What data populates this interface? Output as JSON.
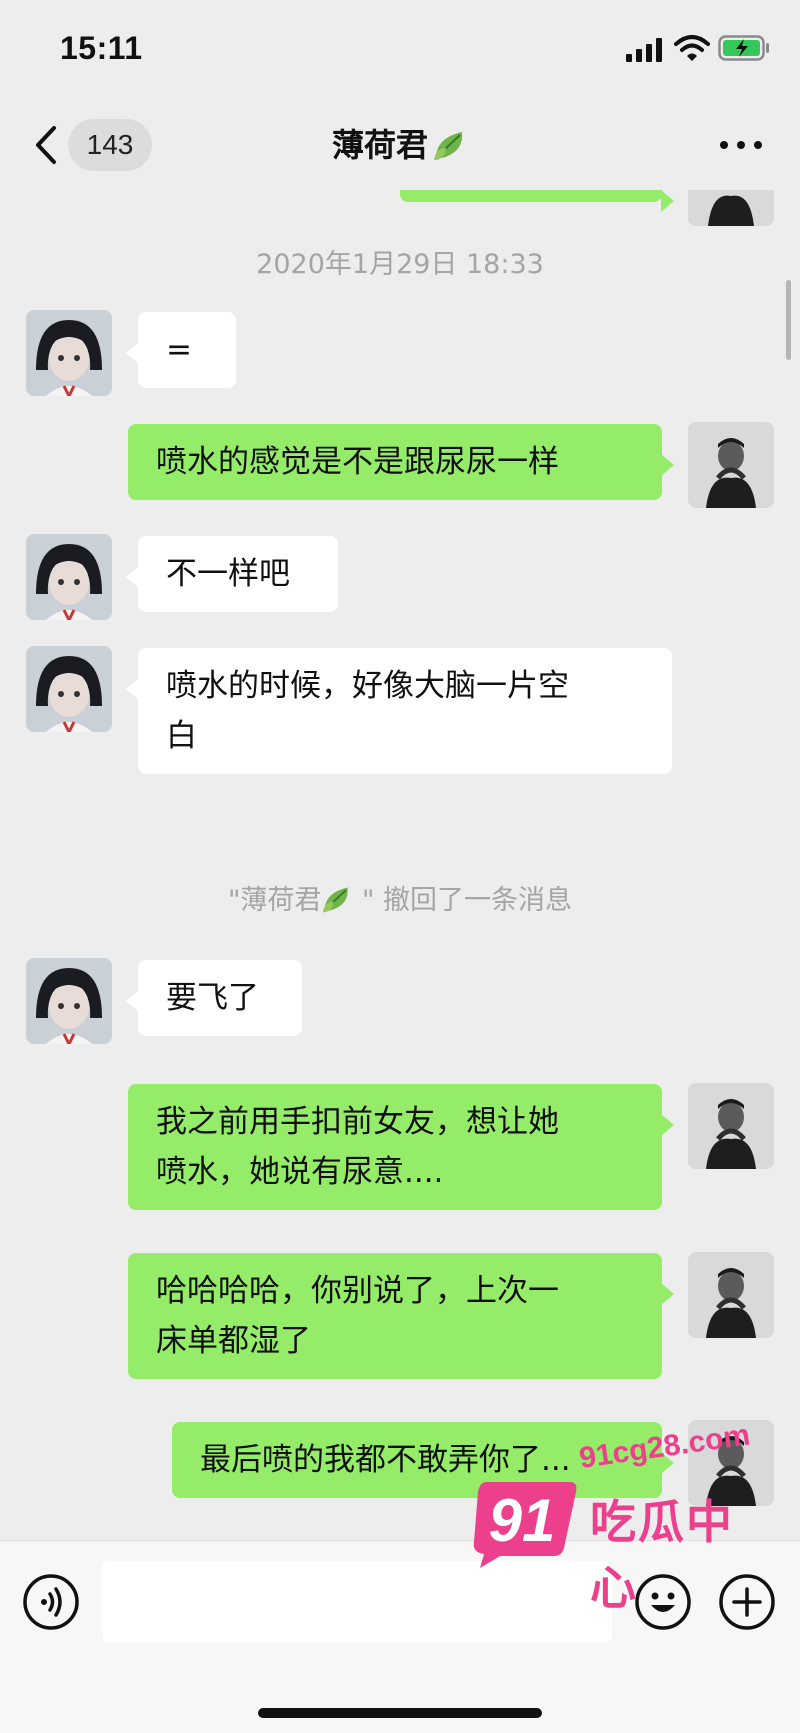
{
  "status_bar": {
    "time": "15:11"
  },
  "header": {
    "back_count": "143",
    "title": "薄荷君",
    "title_emoji": "leaf-emoji"
  },
  "colors": {
    "outgoing_bubble": "#95ec69",
    "incoming_bubble": "#ffffff",
    "background": "#ededed",
    "watermark": "#ec3f8c"
  },
  "conversation": {
    "timestamp": "2020年1月29日 18:33",
    "m1": "=",
    "m2": "喷水的感觉是不是跟尿尿一样",
    "m3": "不一样吧",
    "m4_line1": "喷水的时候，好像大脑一片空",
    "m4_line2": "白",
    "recall_name": "\"薄荷君",
    "recall_text": " \" 撤回了一条消息",
    "m5": "要飞了",
    "m6_line1": "我之前用手扣前女友，想让她",
    "m6_line2": "喷水，她说有尿意....",
    "m7_line1": "哈哈哈哈，你别说了，上次一",
    "m7_line2": "床单都湿了",
    "m8": "最后喷的我都不敢弄你了..."
  },
  "input_bar": {
    "placeholder": "",
    "icons": [
      "voice-icon",
      "emoji-icon",
      "plus-icon"
    ]
  },
  "watermark": {
    "url": "91cg28.com",
    "number": "91",
    "name": "吃瓜中心"
  }
}
